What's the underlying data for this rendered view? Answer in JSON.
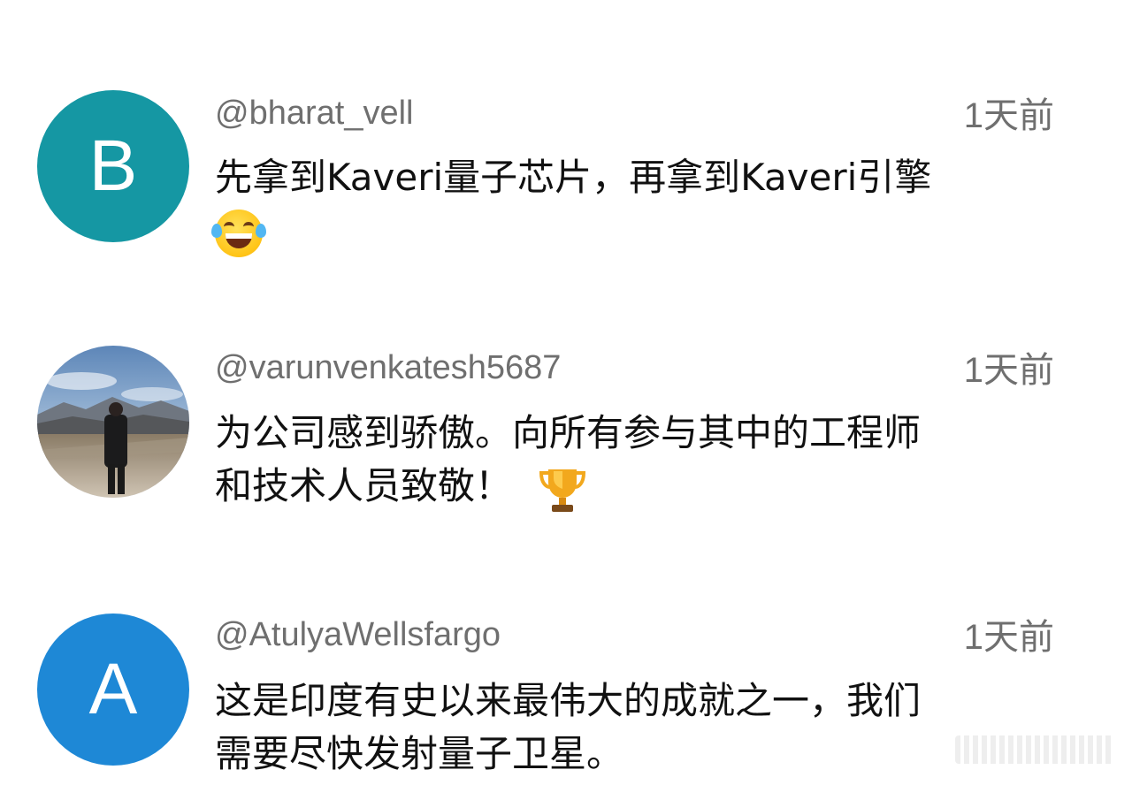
{
  "comments": [
    {
      "username": "@bharat_vell",
      "time": "1天前",
      "avatar_letter": "B",
      "avatar_color": "#1597a3",
      "text_lines": [
        "先拿到Kaveri量子芯片，再拿到Kaveri引擎"
      ],
      "emoji": "face-with-tears-of-joy-icon"
    },
    {
      "username": "@varunvenkatesh5687",
      "time": "1天前",
      "avatar_letter": "",
      "avatar_color": "#8aa7c8",
      "text_lines": [
        "为公司感到骄傲。向所有参与其中的工程师",
        "和技术人员致敬！ "
      ],
      "emoji": "trophy-icon"
    },
    {
      "username": "@AtulyaWellsfargo",
      "time": "1天前",
      "avatar_letter": "A",
      "avatar_color": "#1e88d6",
      "text_lines": [
        "这是印度有史以来最伟大的成就之一，我们",
        "需要尽快发射量子卫星。"
      ],
      "emoji": ""
    }
  ]
}
